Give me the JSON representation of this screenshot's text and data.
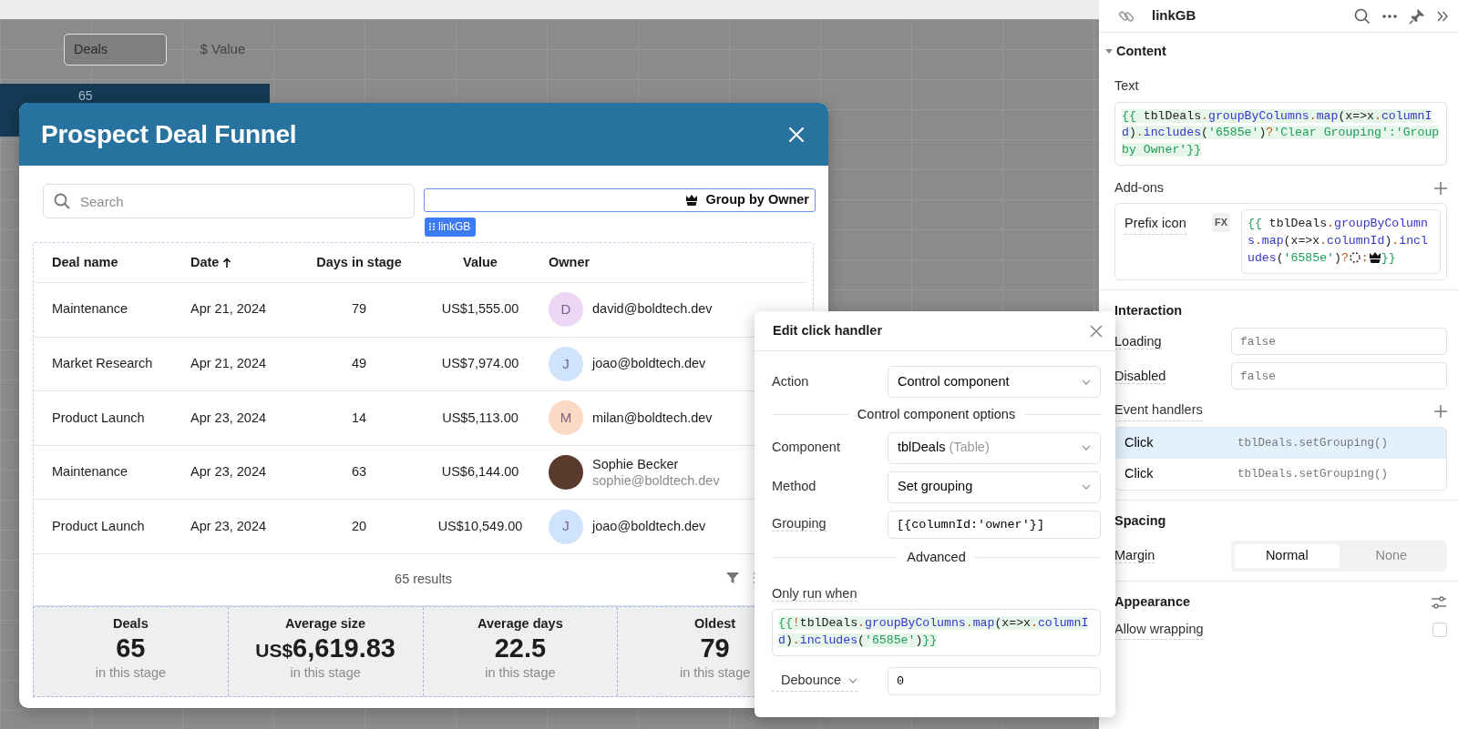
{
  "background_widget": {
    "tabs": [
      {
        "label": "Deals",
        "selected": true
      },
      {
        "label": "$ Value",
        "selected": false
      }
    ],
    "bar_label": "65"
  },
  "modal": {
    "title": "Prospect Deal Funnel",
    "search": {
      "placeholder": "Search"
    },
    "group_link": {
      "label": "Group by Owner",
      "tag": "linkGB"
    },
    "table": {
      "columns": [
        {
          "label": "Deal name",
          "sorted": false
        },
        {
          "label": "Date",
          "sorted": true
        },
        {
          "label": "Days in stage",
          "sorted": false
        },
        {
          "label": "Value",
          "sorted": false
        },
        {
          "label": "Owner",
          "sorted": false
        }
      ],
      "rows": [
        {
          "deal": "Maintenance",
          "date": "Apr 21, 2024",
          "days": "79",
          "value": "US$1,555.00",
          "owner": {
            "kind": "initial",
            "initial": "D",
            "color": "#ecd6f4",
            "email": "david@boldtech.dev"
          }
        },
        {
          "deal": "Market Research",
          "date": "Apr 21, 2024",
          "days": "49",
          "value": "US$7,974.00",
          "owner": {
            "kind": "initial",
            "initial": "J",
            "color": "#cfe3fb",
            "email": "joao@boldtech.dev"
          }
        },
        {
          "deal": "Product Launch",
          "date": "Apr 23, 2024",
          "days": "14",
          "value": "US$5,113.00",
          "owner": {
            "kind": "initial",
            "initial": "M",
            "color": "#fbd9c4",
            "email": "milan@boldtech.dev"
          }
        },
        {
          "deal": "Maintenance",
          "date": "Apr 23, 2024",
          "days": "63",
          "value": "US$6,144.00",
          "owner": {
            "kind": "photo",
            "name": "Sophie Becker",
            "email": "sophie@boldtech.dev"
          }
        },
        {
          "deal": "Product Launch",
          "date": "Apr 23, 2024",
          "days": "20",
          "value": "US$10,549.00",
          "owner": {
            "kind": "initial",
            "initial": "J",
            "color": "#cfe3fb",
            "email": "joao@boldtech.dev"
          }
        }
      ],
      "footer": "65 results"
    },
    "stats": [
      {
        "label": "Deals",
        "value": "65",
        "caption": "in this stage"
      },
      {
        "label": "Average size",
        "prefix": "US$",
        "value": "6,619.83",
        "caption": "in this stage"
      },
      {
        "label": "Average days",
        "value": "22.5",
        "caption": "in this stage"
      },
      {
        "label": "Oldest",
        "value": "79",
        "caption": "in this stage"
      }
    ]
  },
  "click_handler_popup": {
    "title": "Edit click handler",
    "action": {
      "label": "Action",
      "value": "Control component"
    },
    "options_divider": "Control component options",
    "component": {
      "label": "Component",
      "value": "tblDeals",
      "hint": "(Table)"
    },
    "method": {
      "label": "Method",
      "value": "Set grouping"
    },
    "grouping": {
      "label": "Grouping",
      "value": "[{columnId:'owner'}]"
    },
    "advanced_divider": "Advanced",
    "only_run_label": "Only run when",
    "only_run_code": [
      {
        "text": "{{",
        "kind": "brace"
      },
      {
        "text": "!",
        "kind": "op"
      },
      {
        "text": "tblDeals",
        "kind": "ident"
      },
      {
        "text": ".",
        "kind": "op"
      },
      {
        "text": "groupByColumns",
        "kind": "prop"
      },
      {
        "text": ".",
        "kind": "op"
      },
      {
        "text": "map",
        "kind": "prop"
      },
      {
        "text": "(x=>x",
        "kind": "ident"
      },
      {
        "text": ".",
        "kind": "op"
      },
      {
        "text": "columnId",
        "kind": "prop"
      },
      {
        "text": ")",
        "kind": "ident"
      },
      {
        "text": ".",
        "kind": "op"
      },
      {
        "text": "includes",
        "kind": "prop"
      },
      {
        "text": "(",
        "kind": "ident"
      },
      {
        "text": "'6585e'",
        "kind": "string"
      },
      {
        "text": ")",
        "kind": "ident"
      },
      {
        "text": "}}",
        "kind": "brace"
      }
    ],
    "debounce": {
      "label": "Debounce",
      "value": "0"
    }
  },
  "inspector": {
    "title": "linkGB",
    "content": {
      "title": "Content",
      "expanded": true,
      "text_label": "Text",
      "text_code": [
        {
          "text": "{{ ",
          "kind": "brace"
        },
        {
          "text": "tblDeals",
          "kind": "ident"
        },
        {
          "text": ".",
          "kind": "op"
        },
        {
          "text": "groupByColumns",
          "kind": "prop"
        },
        {
          "text": ".",
          "kind": "op"
        },
        {
          "text": "map",
          "kind": "prop"
        },
        {
          "text": "(x=>x",
          "kind": "ident"
        },
        {
          "text": ".",
          "kind": "op"
        },
        {
          "text": "columnId",
          "kind": "prop"
        },
        {
          "text": ")",
          "kind": "ident"
        },
        {
          "text": ".",
          "kind": "op"
        },
        {
          "text": "includes",
          "kind": "prop"
        },
        {
          "text": "(",
          "kind": "ident"
        },
        {
          "text": "'6585e'",
          "kind": "string"
        },
        {
          "text": ")",
          "kind": "ident"
        },
        {
          "text": "?",
          "kind": "op"
        },
        {
          "text": "'Clear Grouping'",
          "kind": "string"
        },
        {
          "text": ":",
          "kind": "brace"
        },
        {
          "text": "'Group by Owner'",
          "kind": "string"
        },
        {
          "text": "}}",
          "kind": "brace"
        }
      ],
      "addons_label": "Add-ons",
      "prefix_label": "Prefix icon",
      "fx": "FX",
      "prefix_code": [
        {
          "text": "{{ ",
          "kind": "brace"
        },
        {
          "text": "tblDeals",
          "kind": "ident"
        },
        {
          "text": ".",
          "kind": "op"
        },
        {
          "text": "groupByColumns",
          "kind": "prop"
        },
        {
          "text": ".",
          "kind": "op"
        },
        {
          "text": "map",
          "kind": "prop"
        },
        {
          "text": "(x=>x",
          "kind": "ident"
        },
        {
          "text": ".",
          "kind": "op"
        },
        {
          "text": "columnId",
          "kind": "prop"
        },
        {
          "text": ")",
          "kind": "ident"
        },
        {
          "text": ".",
          "kind": "op"
        },
        {
          "text": "includes",
          "kind": "prop"
        },
        {
          "text": "(",
          "kind": "ident"
        },
        {
          "text": "'6585e'",
          "kind": "string"
        },
        {
          "text": ")",
          "kind": "ident"
        },
        {
          "text": "?",
          "kind": "op"
        },
        {
          "kind": "icon"
        },
        {
          "text": ":",
          "kind": "op"
        },
        {
          "kind": "icon"
        },
        {
          "text": "}}",
          "kind": "brace"
        }
      ]
    },
    "interaction": {
      "title": "Interaction",
      "fields": [
        {
          "label": "Loading",
          "placeholder": "false"
        },
        {
          "label": "Disabled",
          "placeholder": "false"
        }
      ],
      "handlers_label": "Event handlers",
      "handlers": [
        {
          "event": "Click",
          "action": "tblDeals.setGrouping()",
          "selected": true
        },
        {
          "event": "Click",
          "action": "tblDeals.setGrouping()",
          "selected": false
        }
      ]
    },
    "spacing": {
      "title": "Spacing",
      "margin_label": "Margin",
      "options": [
        {
          "label": "Normal",
          "selected": true
        },
        {
          "label": "None",
          "selected": false
        }
      ]
    },
    "appearance": {
      "title": "Appearance",
      "allow_wrapping": {
        "label": "Allow wrapping",
        "checked": false
      }
    }
  }
}
